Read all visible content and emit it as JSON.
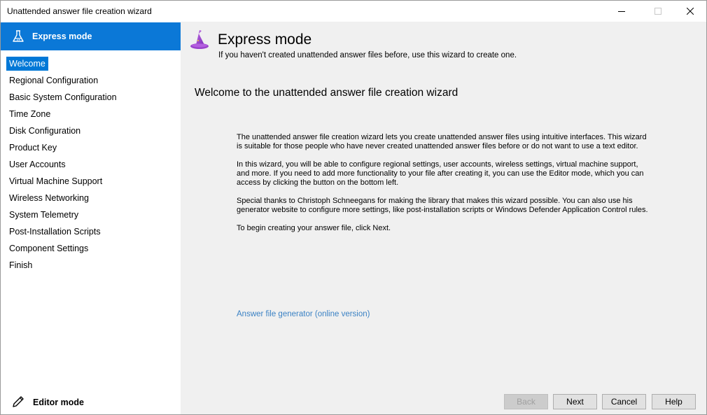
{
  "window": {
    "title": "Unattended answer file creation wizard"
  },
  "sidebar": {
    "mode_header": "Express mode",
    "items": [
      {
        "label": "Welcome",
        "selected": true
      },
      {
        "label": "Regional Configuration"
      },
      {
        "label": "Basic System Configuration"
      },
      {
        "label": "Time Zone"
      },
      {
        "label": "Disk Configuration"
      },
      {
        "label": "Product Key"
      },
      {
        "label": "User Accounts"
      },
      {
        "label": "Virtual Machine Support"
      },
      {
        "label": "Wireless Networking"
      },
      {
        "label": "System Telemetry"
      },
      {
        "label": "Post-Installation Scripts"
      },
      {
        "label": "Component Settings"
      },
      {
        "label": "Finish"
      }
    ],
    "editor_mode": "Editor mode"
  },
  "main": {
    "title": "Express mode",
    "subtitle": "If you haven't created unattended answer files before, use this wizard to create one.",
    "heading": "Welcome to the unattended answer file creation wizard",
    "paragraphs": [
      "The unattended answer file creation wizard lets you create unattended answer files using intuitive interfaces. This wizard is suitable for those people who have never created unattended answer files before or do not want to use a text editor.",
      "In this wizard, you will be able to configure regional settings, user accounts, wireless settings, virtual machine support, and more. If you need to add more functionality to your file after creating it, you can use the Editor mode, which you can access by clicking the button on the bottom left.",
      "Special thanks to Christoph Schneegans for making the library that makes this wizard possible. You can also use his generator website to configure more settings, like post-installation scripts or Windows Defender Application Control rules.",
      "To begin creating your answer file, click Next."
    ],
    "link": "Answer file generator (online version)"
  },
  "buttons": {
    "back": "Back",
    "next": "Next",
    "cancel": "Cancel",
    "help": "Help"
  },
  "colors": {
    "accent": "#0b78d7",
    "selection": "#0078d7",
    "link": "#3b82c4",
    "wizard_hat": "#a44fd1"
  }
}
